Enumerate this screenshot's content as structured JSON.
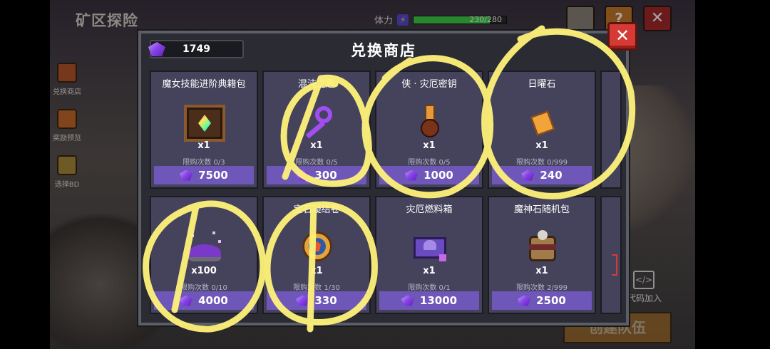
{
  "background": {
    "title": "矿区探险",
    "stamina_label": "体力",
    "stamina_value": "230/280",
    "stamina_fraction": 0.82,
    "help_label": "?",
    "close_label": "✕",
    "side_nav": [
      {
        "label": "兑换商店",
        "icon": "shop-icon",
        "color": "#b5552b"
      },
      {
        "label": "奖励预览",
        "icon": "chest-icon",
        "color": "#c66b2b"
      },
      {
        "label": "选择BD",
        "icon": "question-icon",
        "color": "#a88a3a"
      }
    ],
    "code_join_label": "代码加入",
    "create_team_label": "创建队伍"
  },
  "shop": {
    "title": "兑换商店",
    "currency_amount": "1749",
    "close_label": "✕",
    "items": [
      {
        "name": "魔女技能进阶典籍包",
        "qty": "x1",
        "limit": "限购次数 0/3",
        "price": "7500",
        "icon": "spellbook-icon"
      },
      {
        "name": "混沌之匙",
        "qty": "x1",
        "limit": "限购次数 0/5",
        "price": "300",
        "icon": "purple-key-icon"
      },
      {
        "name": "侠 · 灾厄密钥",
        "qty": "x1",
        "limit": "限购次数 0/5",
        "price": "1000",
        "icon": "calamity-key-icon"
      },
      {
        "name": "日曜石",
        "qty": "x1",
        "limit": "限购次数 0/999",
        "price": "240",
        "icon": "sunstone-icon"
      },
      {
        "name": "",
        "qty": "x100",
        "limit": "限购次数 0/10",
        "price": "4000",
        "icon": "purple-dust-icon"
      },
      {
        "name": "宝石凝结卷",
        "qty": "x1",
        "limit": "限购次数 1/30",
        "price": "330",
        "icon": "gem-medal-icon"
      },
      {
        "name": "灾厄燃料箱",
        "qty": "x1",
        "limit": "限购次数 0/1",
        "price": "13000",
        "icon": "fuel-chest-icon"
      },
      {
        "name": "魔神石随机包",
        "qty": "x1",
        "limit": "限购次数 2/999",
        "price": "2500",
        "icon": "demon-stone-bag-icon"
      }
    ]
  },
  "colors": {
    "panel_bg": "#2b2c33",
    "card_bg": "#45425c",
    "price_bar": "#6e57b8",
    "gem": "#8a45ea",
    "close_red": "#d63a35",
    "highlight": "#fff27a"
  }
}
